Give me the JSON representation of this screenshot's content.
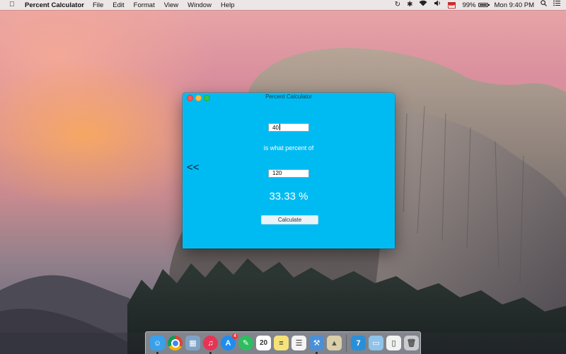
{
  "menubar": {
    "app_name": "Percent Calculator",
    "menus": [
      "File",
      "Edit",
      "Format",
      "View",
      "Window",
      "Help"
    ],
    "battery_percent": "99%",
    "clock": "Mon 9:40 PM"
  },
  "window": {
    "title": "Percent Calculator",
    "back_label": "<<",
    "first_value": "40",
    "middle_label": "is what percent of",
    "second_value": "120",
    "result": "33.33 %",
    "calculate_label": "Calculate"
  },
  "dock": {
    "items": [
      {
        "name": "finder-icon",
        "color": "#3aa0ea",
        "glyph": "☺"
      },
      {
        "name": "chrome-icon",
        "color": "#e9e9e9",
        "glyph": ""
      },
      {
        "name": "preview-icon",
        "color": "#7fa3c7",
        "glyph": "▦"
      },
      {
        "name": "itunes-icon",
        "color": "#e63454",
        "glyph": "♫"
      },
      {
        "name": "app-store-icon",
        "color": "#1e8cf0",
        "glyph": "A",
        "badge": "4"
      },
      {
        "name": "evernote-icon",
        "color": "#2dbe60",
        "glyph": "✎"
      },
      {
        "name": "calendar-icon",
        "color": "#ffffff",
        "glyph": "20"
      },
      {
        "name": "notes-icon",
        "color": "#f5e37a",
        "glyph": "≡"
      },
      {
        "name": "reminders-icon",
        "color": "#f4f4f4",
        "glyph": "☰"
      },
      {
        "name": "xcode-icon",
        "color": "#4b8fd6",
        "glyph": "⚒"
      },
      {
        "name": "instruments-icon",
        "color": "#d9cfa9",
        "glyph": "▲"
      },
      {
        "name": "applications-folder-icon",
        "color": "#2a8fd7",
        "glyph": "7"
      },
      {
        "name": "documents-folder-icon",
        "color": "#8fc3ea",
        "glyph": "▭"
      },
      {
        "name": "file-icon",
        "color": "#f2f2f2",
        "glyph": "▯"
      },
      {
        "name": "trash-icon",
        "color": "#c9cbd0",
        "glyph": "🗑"
      }
    ],
    "calendar_day": "20"
  }
}
